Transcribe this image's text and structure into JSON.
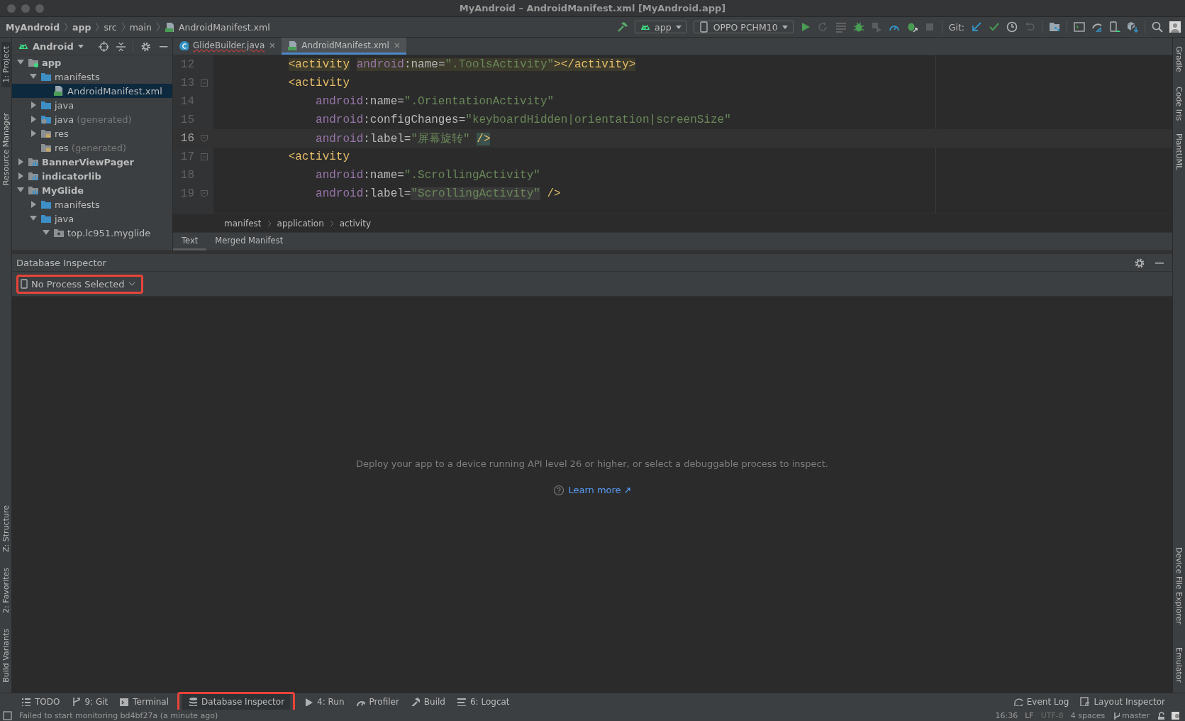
{
  "window": {
    "title": "MyAndroid – AndroidManifest.xml [MyAndroid.app]"
  },
  "nav_bar": {
    "breadcrumbs": [
      "MyAndroid",
      "app",
      "src",
      "main",
      "AndroidManifest.xml"
    ]
  },
  "toolbar": {
    "config": "app",
    "device": "OPPO PCHM10",
    "git_label": "Git:"
  },
  "left_strip": [
    {
      "label": "1: Project",
      "selected": true
    },
    {
      "label": "Resource Manager",
      "selected": false
    },
    {
      "label": "Z: Structure",
      "selected": false
    },
    {
      "label": "2: Favorites",
      "selected": false
    },
    {
      "label": "Build Variants",
      "selected": false
    }
  ],
  "right_strip": [
    {
      "label": "Gradle",
      "selected": false
    },
    {
      "label": "Code Iris",
      "selected": false
    },
    {
      "label": "PlantUML",
      "selected": false
    },
    {
      "label": "Device File Explorer",
      "selected": false
    },
    {
      "label": "Emulator",
      "selected": false
    }
  ],
  "project_panel": {
    "view": "Android",
    "tree": [
      {
        "label": "app",
        "kind": "app",
        "expanded": true,
        "selected": false,
        "children": [
          {
            "label": "manifests",
            "kind": "folder",
            "expanded": true,
            "selected": false,
            "children": [
              {
                "label": "AndroidManifest.xml",
                "kind": "manifest",
                "selected": true
              }
            ]
          },
          {
            "label": "java",
            "kind": "folder",
            "expanded": false,
            "selected": false
          },
          {
            "label": "java",
            "suffix": "(generated)",
            "kind": "generated",
            "expanded": false,
            "selected": false
          },
          {
            "label": "res",
            "kind": "res",
            "expanded": false,
            "selected": false
          },
          {
            "label": "res",
            "suffix": "(generated)",
            "kind": "res",
            "selected": false
          }
        ]
      },
      {
        "label": "BannerViewPager",
        "kind": "module",
        "expanded": false,
        "selected": false
      },
      {
        "label": "indicatorlib",
        "kind": "module",
        "expanded": false,
        "selected": false
      },
      {
        "label": "MyGlide",
        "kind": "module",
        "expanded": true,
        "selected": false,
        "children": [
          {
            "label": "manifests",
            "kind": "folder",
            "expanded": false,
            "selected": false
          },
          {
            "label": "java",
            "kind": "folder",
            "expanded": true,
            "selected": false,
            "children": [
              {
                "label": "top.lc951.myglide",
                "kind": "package",
                "expanded": true,
                "selected": false
              }
            ]
          }
        ]
      }
    ]
  },
  "editor": {
    "tabs": [
      {
        "label": "GlideBuilder.java",
        "kind": "java",
        "selected": false
      },
      {
        "label": "AndroidManifest.xml",
        "kind": "manifest",
        "selected": true
      }
    ],
    "lines": [
      {
        "number": "12",
        "current": false,
        "fold_start": false,
        "fold_end": false,
        "tokens": [
          {
            "kind": "tag",
            "text": "           <activity",
            "tag_match": true
          },
          {
            "kind": "ns",
            "text": " android",
            "tag_match": true
          },
          {
            "kind": "attr",
            "text": ":name=",
            "tag_match": true
          },
          {
            "kind": "value",
            "text": "\".ToolsActivity\"",
            "tag_match": true
          },
          {
            "kind": "tag",
            "text": "></activity>",
            "tag_match": true
          }
        ]
      },
      {
        "number": "13",
        "current": false,
        "fold_start": true,
        "fold_end": false,
        "tokens": [
          {
            "kind": "tag",
            "text": "           <activity"
          }
        ]
      },
      {
        "number": "14",
        "current": false,
        "fold_start": false,
        "fold_end": false,
        "tokens": [
          {
            "kind": "ns",
            "text": "               android"
          },
          {
            "kind": "attr",
            "text": ":name="
          },
          {
            "kind": "value",
            "text": "\".OrientationActivity\""
          }
        ]
      },
      {
        "number": "15",
        "current": false,
        "fold_start": false,
        "fold_end": false,
        "tokens": [
          {
            "kind": "ns",
            "text": "               android"
          },
          {
            "kind": "attr",
            "text": ":configChanges="
          },
          {
            "kind": "value",
            "text": "\"keyboardHidden|orientation|screenSize\""
          }
        ]
      },
      {
        "number": "16",
        "current": true,
        "fold_start": false,
        "fold_end": true,
        "tokens": [
          {
            "kind": "ns",
            "text": "               android"
          },
          {
            "kind": "attr",
            "text": ":label="
          },
          {
            "kind": "value",
            "text": "\"屏幕旋转\" "
          },
          {
            "kind": "tag",
            "text": "/>",
            "brace_match": true
          }
        ]
      },
      {
        "number": "17",
        "current": false,
        "fold_start": true,
        "fold_end": false,
        "tokens": [
          {
            "kind": "tag",
            "text": "           <activity"
          }
        ]
      },
      {
        "number": "18",
        "current": false,
        "fold_start": false,
        "fold_end": false,
        "tokens": [
          {
            "kind": "ns",
            "text": "               android"
          },
          {
            "kind": "attr",
            "text": ":name="
          },
          {
            "kind": "value",
            "text": "\".ScrollingActivity\""
          }
        ]
      },
      {
        "number": "19",
        "current": false,
        "fold_start": false,
        "fold_end": true,
        "tokens": [
          {
            "kind": "ns",
            "text": "               android"
          },
          {
            "kind": "attr",
            "text": ":label="
          },
          {
            "kind": "value",
            "text": "\"ScrollingActivity\"",
            "usage_match": true
          },
          {
            "kind": "tag",
            "text": " />"
          }
        ]
      }
    ],
    "breadcrumbs": [
      "manifest",
      "application",
      "activity"
    ],
    "view_tabs": [
      {
        "label": "Text",
        "selected": true
      },
      {
        "label": "Merged Manifest",
        "selected": false
      }
    ]
  },
  "database_inspector": {
    "title": "Database Inspector",
    "process": "No Process Selected",
    "message": "Deploy your app to a device running API level 26 or higher, or select a debuggable process to inspect.",
    "link": "Learn more"
  },
  "tool_windows": [
    {
      "label": "TODO",
      "kind": "todo",
      "selected": false
    },
    {
      "label": "9: Git",
      "kind": "git",
      "selected": false
    },
    {
      "label": "Terminal",
      "kind": "terminal",
      "selected": false
    },
    {
      "label": "Database Inspector",
      "kind": "database",
      "selected": true
    },
    {
      "label": "4: Run",
      "kind": "run",
      "selected": false
    },
    {
      "label": "Profiler",
      "kind": "profiler",
      "selected": false
    },
    {
      "label": "Build",
      "kind": "build",
      "selected": false
    },
    {
      "label": "6: Logcat",
      "kind": "logcat",
      "selected": false
    }
  ],
  "tool_windows_right": [
    {
      "label": "Event Log",
      "kind": "event"
    },
    {
      "label": "Layout Inspector",
      "kind": "layout"
    }
  ],
  "status_bar": {
    "message": "Failed to start monitoring bd4bf27a (a minute ago)",
    "items": [
      "16:36",
      "LF",
      "UTF-8",
      "4 spaces",
      "master"
    ]
  }
}
